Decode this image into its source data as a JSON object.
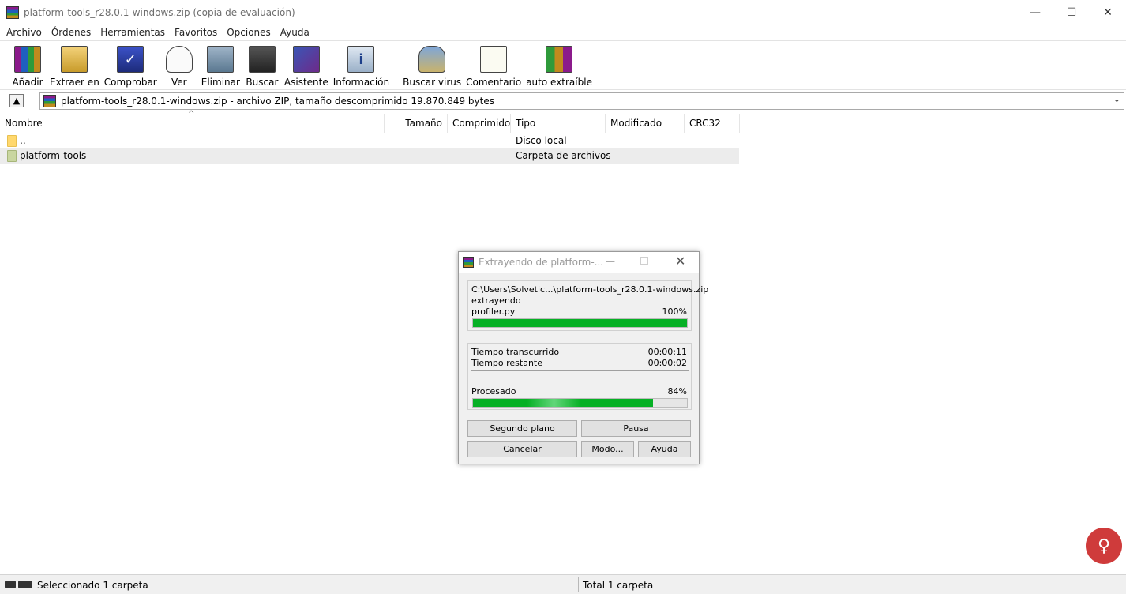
{
  "window": {
    "title": "platform-tools_r28.0.1-windows.zip (copia de evaluación)",
    "minimize_glyph": "—",
    "maximize_glyph": "☐",
    "close_glyph": "✕"
  },
  "menu": [
    "Archivo",
    "Órdenes",
    "Herramientas",
    "Favoritos",
    "Opciones",
    "Ayuda"
  ],
  "toolbar": [
    {
      "label": "Añadir",
      "icon": "add-archive-icon"
    },
    {
      "label": "Extraer en",
      "icon": "extract-to-icon"
    },
    {
      "label": "Comprobar",
      "icon": "test-icon"
    },
    {
      "label": "Ver",
      "icon": "view-icon"
    },
    {
      "label": "Eliminar",
      "icon": "delete-icon"
    },
    {
      "label": "Buscar",
      "icon": "find-icon"
    },
    {
      "label": "Asistente",
      "icon": "wizard-icon"
    },
    {
      "label": "Información",
      "icon": "info-icon"
    },
    {
      "label": "Buscar virus",
      "icon": "virus-scan-icon"
    },
    {
      "label": "Comentario",
      "icon": "comment-icon"
    },
    {
      "label": "auto extraíble",
      "icon": "sfx-icon"
    }
  ],
  "address": {
    "path": "platform-tools_r28.0.1-windows.zip - archivo ZIP, tamaño descomprimido 19.870.849 bytes"
  },
  "columns": [
    "Nombre",
    "Tamaño",
    "Comprimido",
    "Tipo",
    "Modificado",
    "CRC32"
  ],
  "rows": [
    {
      "name": "..",
      "size": "",
      "packed": "",
      "type": "Disco local",
      "modified": "",
      "crc": ""
    },
    {
      "name": "platform-tools",
      "size": "",
      "packed": "",
      "type": "Carpeta de archivos",
      "modified": "",
      "crc": ""
    }
  ],
  "status": {
    "left": "Seleccionado 1 carpeta",
    "right": "Total 1 carpeta"
  },
  "dialog": {
    "title": "Extrayendo de platform-...",
    "archive_path": "C:\\Users\\Solvetic...\\platform-tools_r28.0.1-windows.zip",
    "action": "extrayendo",
    "current_file": "profiler.py",
    "file_progress_text": "100%",
    "file_progress": 1.0,
    "elapsed_label": "Tiempo transcurrido",
    "elapsed": "00:00:11",
    "remaining_label": "Tiempo restante",
    "remaining": "00:00:02",
    "processed_label": "Procesado",
    "processed_text": "84%",
    "processed_progress": 0.84,
    "buttons": {
      "background": "Segundo plano",
      "pause": "Pausa",
      "cancel": "Cancelar",
      "mode": "Modo...",
      "help": "Ayuda"
    }
  },
  "colors": {
    "progress_green": "#06b025",
    "selected_row": "#ececec"
  }
}
